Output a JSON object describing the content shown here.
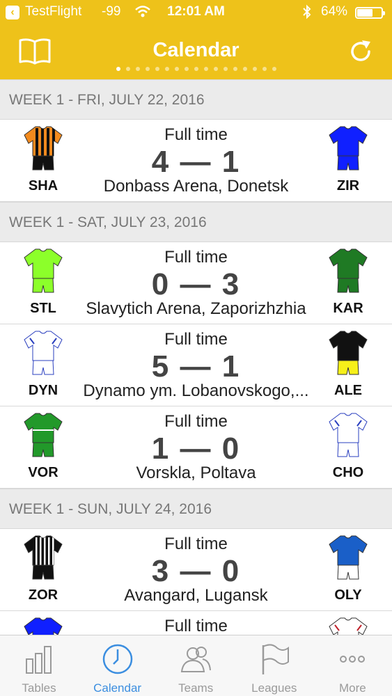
{
  "status_bar": {
    "back_app": "TestFlight",
    "signal": "-99",
    "time": "12:01 AM",
    "battery": "64%",
    "battery_level": 0.64
  },
  "nav": {
    "title": "Calendar",
    "left_icon": "book-icon",
    "right_icon": "refresh-icon",
    "page_dots": 17,
    "active_dot": 0
  },
  "sections": [
    {
      "header": "WEEK 1 - FRI, JULY 22, 2016",
      "matches": [
        {
          "status": "Full time",
          "score": "4 — 1",
          "venue": "Donbass Arena, Donetsk",
          "home": "SHA",
          "away": "ZIR",
          "home_kit": "stripes-orange-black",
          "away_kit": "blue"
        }
      ]
    },
    {
      "header": "WEEK 1 - SAT, JULY 23, 2016",
      "matches": [
        {
          "status": "Full time",
          "score": "0 — 3",
          "venue": "Slavytich Arena, Zaporizhzhia",
          "home": "STL",
          "away": "KAR",
          "home_kit": "lime",
          "away_kit": "green"
        },
        {
          "status": "Full time",
          "score": "5 — 1",
          "venue": "Dynamo ym. Lobanovskogo,...",
          "home": "DYN",
          "away": "ALE",
          "home_kit": "white-blue",
          "away_kit": "black-yellow"
        },
        {
          "status": "Full time",
          "score": "1 — 0",
          "venue": "Vorskla, Poltava",
          "home": "VOR",
          "away": "CHO",
          "home_kit": "green-white",
          "away_kit": "white-blue"
        }
      ]
    },
    {
      "header": "WEEK 1 - SUN, JULY 24, 2016",
      "matches": [
        {
          "status": "Full time",
          "score": "3 — 0",
          "venue": "Avangard, Lugansk",
          "home": "ZOR",
          "away": "OLY",
          "home_kit": "stripes-black-white",
          "away_kit": "blue-white"
        },
        {
          "status": "Full time",
          "score": "",
          "venue": "",
          "home": "",
          "away": "",
          "home_kit": "blue",
          "away_kit": "white-red"
        }
      ]
    }
  ],
  "tabs": [
    {
      "label": "Tables",
      "icon": "bar-chart-icon",
      "active": false
    },
    {
      "label": "Calendar",
      "icon": "clock-icon",
      "active": true
    },
    {
      "label": "Teams",
      "icon": "people-icon",
      "active": false
    },
    {
      "label": "Leagues",
      "icon": "flag-icon",
      "active": false
    },
    {
      "label": "More",
      "icon": "more-dots-icon",
      "active": false
    }
  ],
  "colors": {
    "header_yellow": "#eec21a",
    "active_tab": "#3b8ee0",
    "inactive_tab": "#9a9a9a",
    "section_bg": "#ebebeb"
  }
}
